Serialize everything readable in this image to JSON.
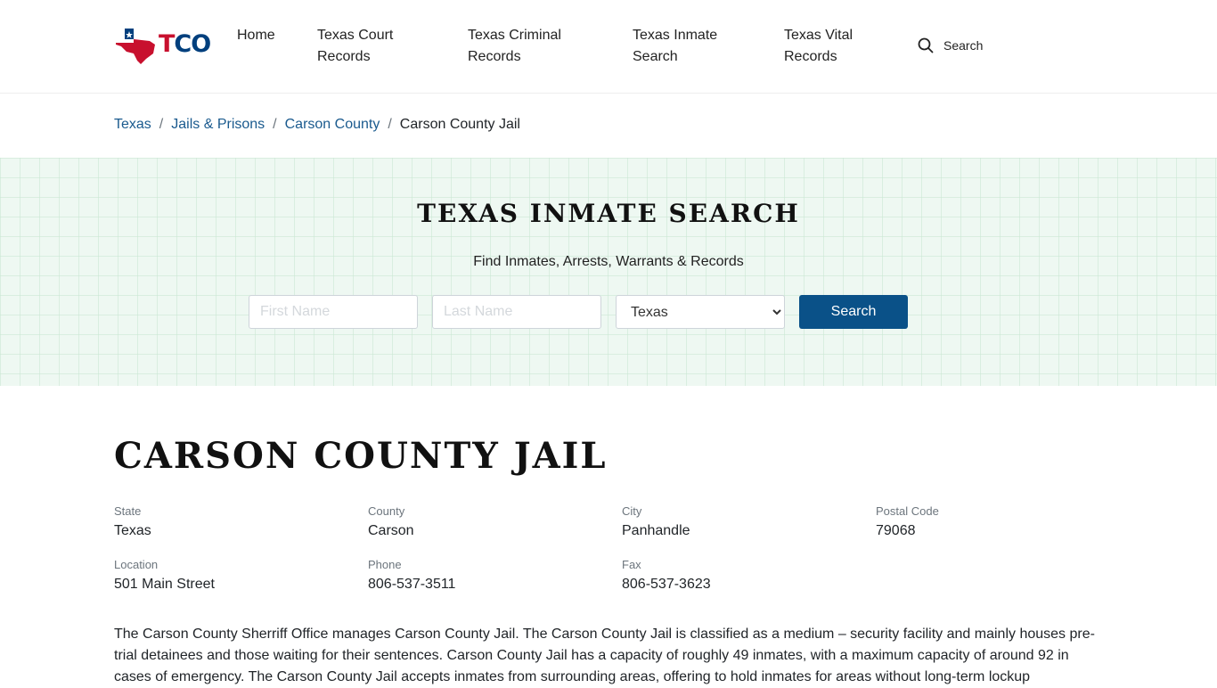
{
  "brand": {
    "logo_letters": [
      "T",
      "C",
      "O"
    ]
  },
  "nav": {
    "items": [
      {
        "line1": "Home",
        "line2": ""
      },
      {
        "line1": "Texas Court",
        "line2": "Records"
      },
      {
        "line1": "Texas Criminal",
        "line2": "Records"
      },
      {
        "line1": "Texas Inmate",
        "line2": "Search"
      },
      {
        "line1": "Texas Vital",
        "line2": "Records"
      }
    ],
    "search_label": "Search"
  },
  "breadcrumb": {
    "links": [
      "Texas",
      "Jails & Prisons",
      "Carson County"
    ],
    "separator": "/",
    "current": "Carson County Jail"
  },
  "hero": {
    "title": "TEXAS INMATE SEARCH",
    "subtitle": "Find Inmates, Arrests, Warrants & Records",
    "first_name_placeholder": "First Name",
    "last_name_placeholder": "Last Name",
    "state_selected": "Texas",
    "button_label": "Search"
  },
  "facility": {
    "title": "CARSON COUNTY JAIL",
    "fields": [
      {
        "label": "State",
        "value": "Texas"
      },
      {
        "label": "County",
        "value": "Carson"
      },
      {
        "label": "City",
        "value": "Panhandle"
      },
      {
        "label": "Postal Code",
        "value": "79068"
      },
      {
        "label": "Location",
        "value": "501 Main Street"
      },
      {
        "label": "Phone",
        "value": "806-537-3511"
      },
      {
        "label": "Fax",
        "value": "806-537-3623"
      }
    ],
    "description": "The Carson County Sherriff Office manages Carson County Jail. The Carson County Jail is classified as a medium – security facility and mainly houses pre-trial detainees and those waiting for their sentences. Carson County Jail has a capacity of roughly 49 inmates, with a maximum capacity of around 92 in cases of emergency. The Carson County Jail accepts inmates from surrounding areas, offering to hold inmates for areas without long-term lockup"
  },
  "colors": {
    "accent": "#0a5188",
    "link": "#1a5a8e",
    "brand_red": "#c8102e",
    "brand_blue": "#003f7d",
    "hero_bg": "#eef8f2"
  }
}
